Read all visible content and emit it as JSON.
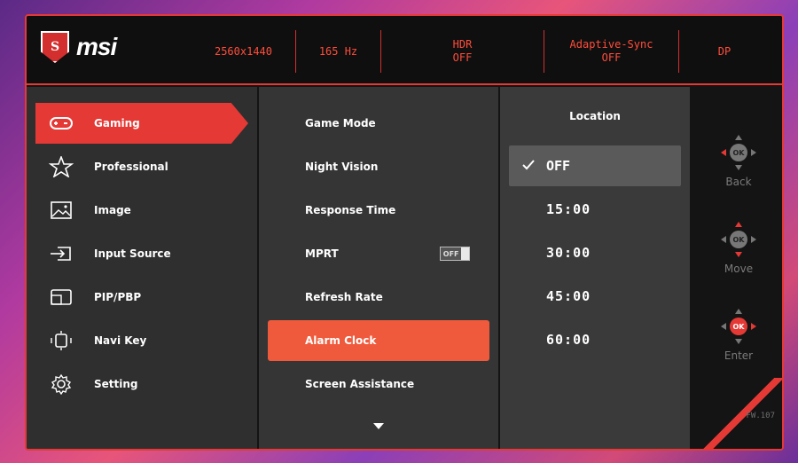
{
  "brand": {
    "logo_mark": "S",
    "logo_text": "msi"
  },
  "header": {
    "resolution": "2560x1440",
    "refresh": "165 Hz",
    "hdr_label": "HDR",
    "hdr_value": "OFF",
    "sync_label": "Adaptive-Sync",
    "sync_value": "OFF",
    "port": "DP"
  },
  "categories": [
    {
      "label": "Gaming",
      "icon": "gamepad-icon",
      "active": true
    },
    {
      "label": "Professional",
      "icon": "star-icon"
    },
    {
      "label": "Image",
      "icon": "image-icon"
    },
    {
      "label": "Input Source",
      "icon": "input-source-icon"
    },
    {
      "label": "PIP/PBP",
      "icon": "pip-icon"
    },
    {
      "label": "Navi Key",
      "icon": "navi-key-icon"
    },
    {
      "label": "Setting",
      "icon": "gear-icon"
    }
  ],
  "menu": [
    {
      "label": "Game Mode"
    },
    {
      "label": "Night Vision"
    },
    {
      "label": "Response Time"
    },
    {
      "label": "MPRT",
      "toggle": "OFF"
    },
    {
      "label": "Refresh Rate"
    },
    {
      "label": "Alarm Clock",
      "active": true
    },
    {
      "label": "Screen Assistance"
    }
  ],
  "values": {
    "header": "Location",
    "items": [
      {
        "label": "OFF",
        "selected": true
      },
      {
        "label": "15:00"
      },
      {
        "label": "30:00"
      },
      {
        "label": "45:00"
      },
      {
        "label": "60:00"
      }
    ]
  },
  "nav": {
    "back": "Back",
    "move": "Move",
    "enter": "Enter",
    "ok": "OK",
    "firmware": "FW.107"
  },
  "colors": {
    "accent": "#e53935",
    "active_item": "#f05a3c",
    "stat_text": "#ff4d3b"
  }
}
